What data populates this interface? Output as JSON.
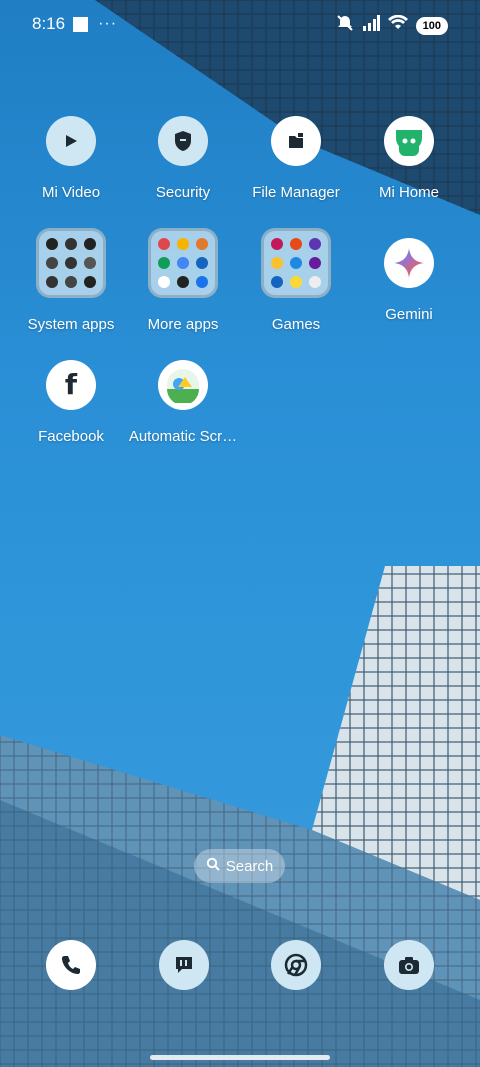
{
  "statusbar": {
    "time": "8:16",
    "overflow": "···",
    "battery": "100"
  },
  "apps": [
    {
      "label": "Mi Video",
      "icon": "play-icon"
    },
    {
      "label": "Security",
      "icon": "shield-icon"
    },
    {
      "label": "File Manager",
      "icon": "folder-icon"
    },
    {
      "label": "Mi Home",
      "icon": "mi-home-icon"
    },
    {
      "label": "System apps",
      "icon": "folder-system-apps"
    },
    {
      "label": "More apps",
      "icon": "folder-more-apps"
    },
    {
      "label": "Games",
      "icon": "folder-games"
    },
    {
      "label": "Gemini",
      "icon": "gemini-icon"
    },
    {
      "label": "Facebook",
      "icon": "facebook-icon"
    },
    {
      "label": "Automatic Scr…",
      "icon": "automatic-screen-icon"
    }
  ],
  "search": {
    "label": "Search"
  },
  "dock": [
    {
      "name": "phone-icon"
    },
    {
      "name": "messages-icon"
    },
    {
      "name": "chrome-icon"
    },
    {
      "name": "camera-icon"
    }
  ],
  "colors": {
    "sky": "#2a8fd6",
    "icon_light": "#cfe7f3",
    "folder_bg": "#bedcee"
  }
}
